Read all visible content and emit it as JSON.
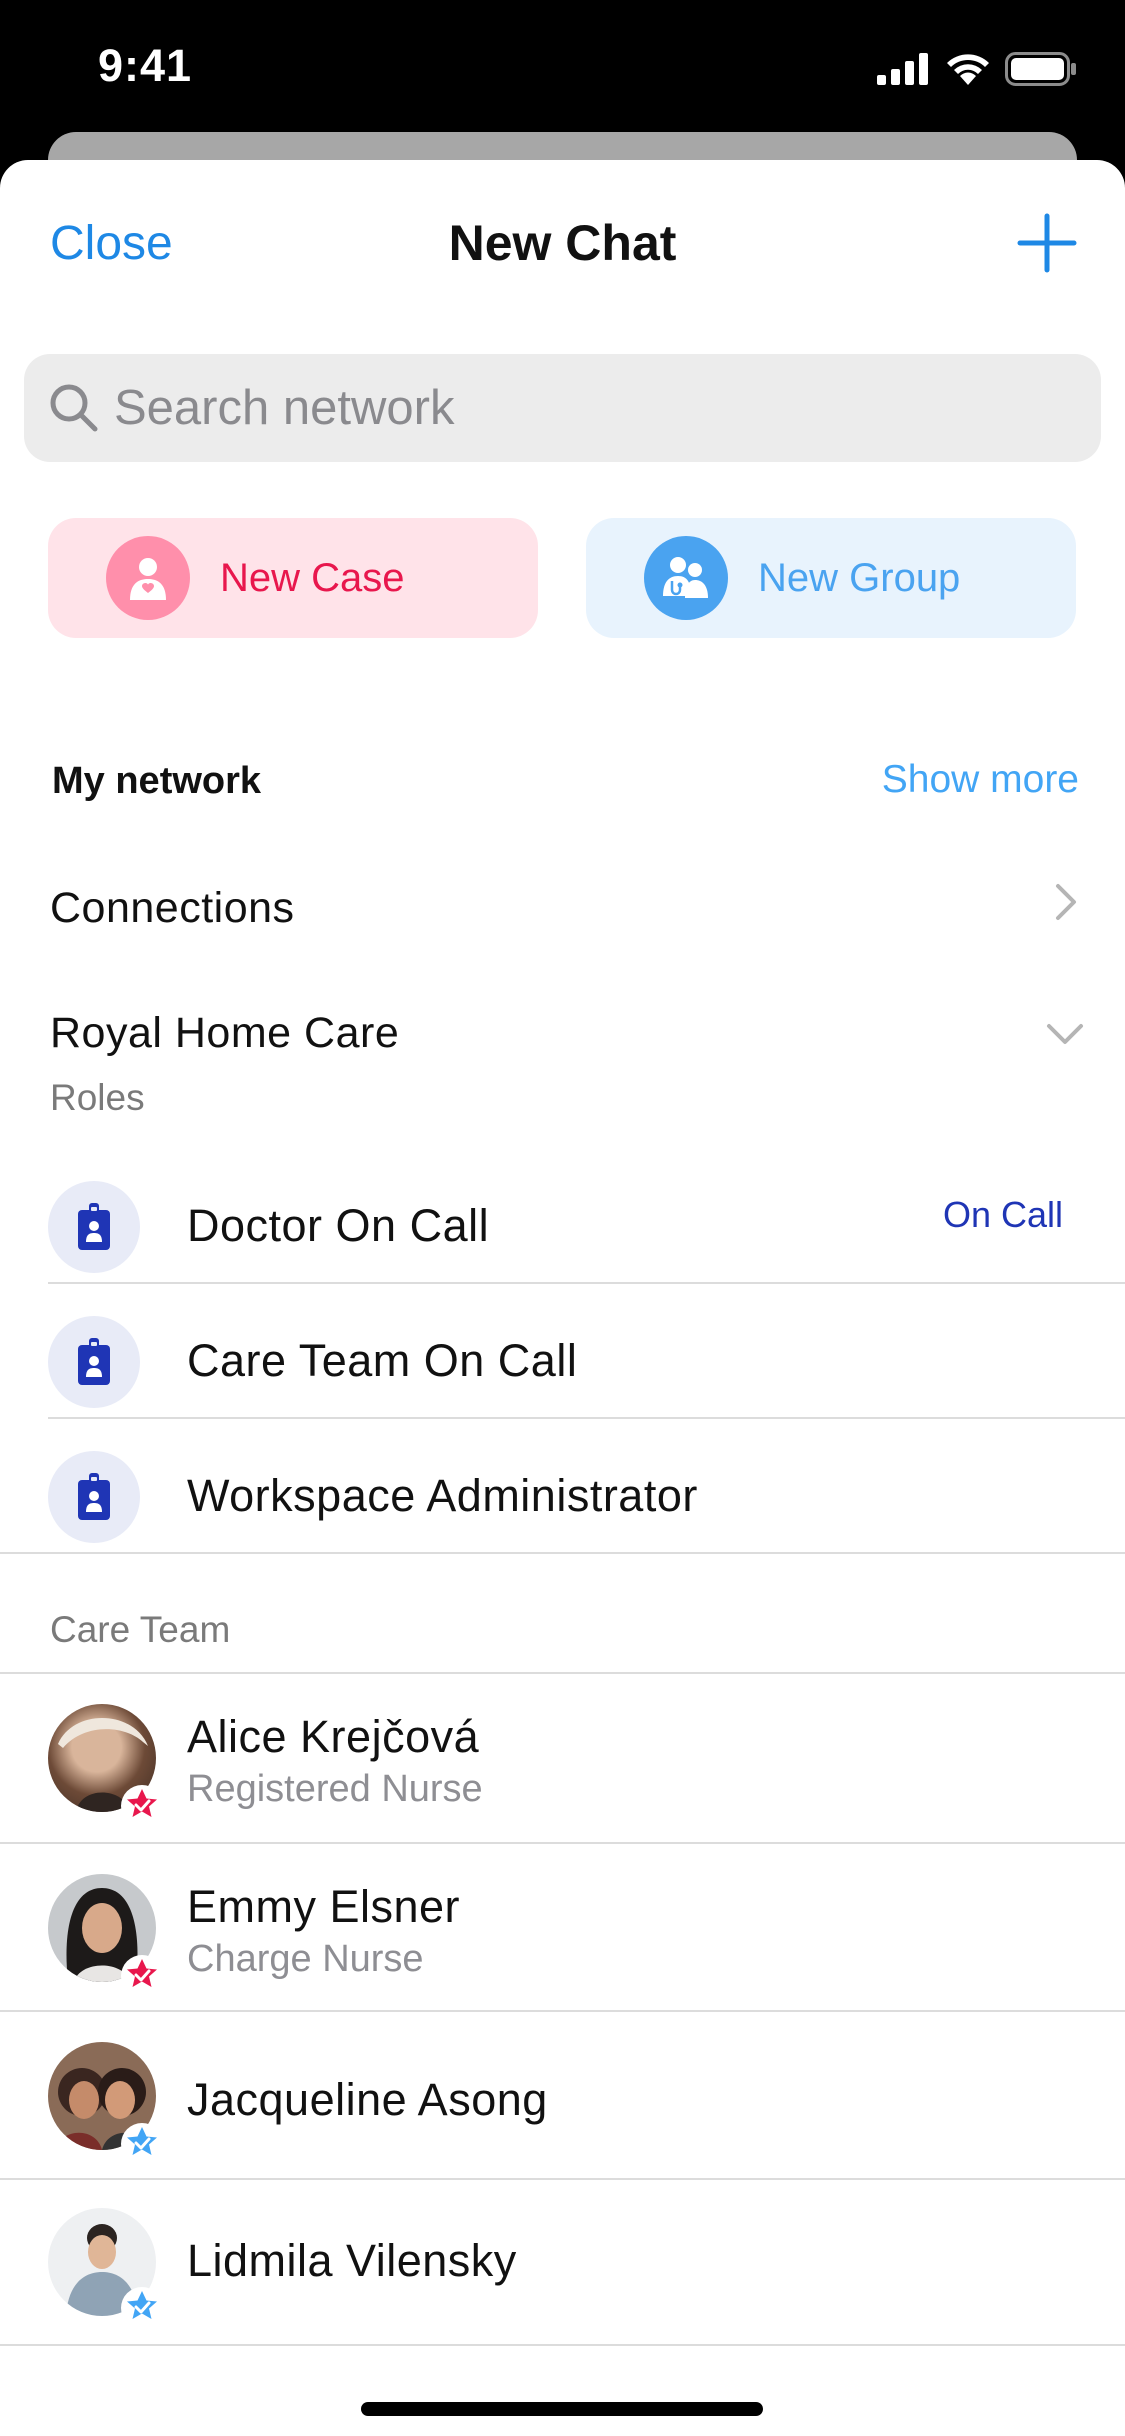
{
  "status_bar": {
    "time": "9:41"
  },
  "nav": {
    "close_label": "Close",
    "title": "New Chat"
  },
  "search": {
    "placeholder": "Search network"
  },
  "actions": {
    "new_case_label": "New Case",
    "new_group_label": "New Group"
  },
  "network": {
    "heading": "My network",
    "show_more_label": "Show more",
    "connections_label": "Connections",
    "org_name": "Royal Home Care",
    "roles_label": "Roles",
    "roles": [
      {
        "label": "Doctor On Call",
        "badge": "On Call"
      },
      {
        "label": "Care Team On Call",
        "badge": ""
      },
      {
        "label": "Workspace Administrator",
        "badge": ""
      }
    ]
  },
  "care_team": {
    "heading": "Care Team",
    "members": [
      {
        "name": "Alice Krejčová",
        "role": "Registered Nurse"
      },
      {
        "name": "Emmy Elsner",
        "role": "Charge Nurse"
      },
      {
        "name": "Jacqueline Asong",
        "role": ""
      },
      {
        "name": "Lidmila Vilensky",
        "role": ""
      }
    ]
  },
  "colors": {
    "accent": "#1e88e5",
    "case_pink": "#ff8fab",
    "group_blue": "#4aa3f0",
    "role_blue": "#1f35b5",
    "badge_red": "#e8174d",
    "badge_blue": "#42a5f5"
  }
}
